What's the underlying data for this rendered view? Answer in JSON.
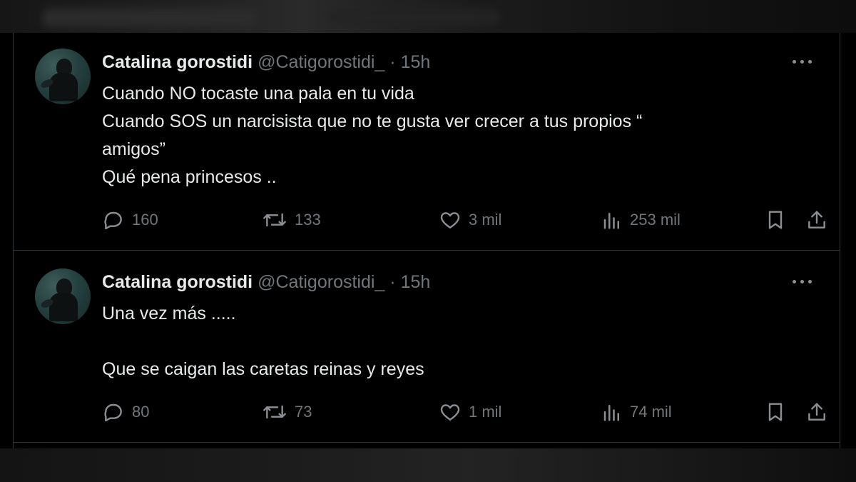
{
  "tweets": [
    {
      "author_name": "Catalina gorostidi",
      "handle": "@Catigorostidi_",
      "separator": "·",
      "time": "15h",
      "lines": [
        "Cuando NO tocaste una pala en tu vida",
        "Cuando SOS un narcisista que no te gusta ver crecer a tus propios “",
        "amigos”",
        "Qué pena princesos .."
      ],
      "replies": "160",
      "retweets": "133",
      "likes": "3 mil",
      "views": "253 mil"
    },
    {
      "author_name": "Catalina gorostidi",
      "handle": "@Catigorostidi_",
      "separator": "·",
      "time": "15h",
      "lines": [
        "Una vez más .....",
        "",
        "Que se caigan las caretas reinas y reyes"
      ],
      "replies": "80",
      "retweets": "73",
      "likes": "1 mil",
      "views": "74 mil"
    }
  ],
  "icons": {
    "reply": "speech-bubble-icon",
    "retweet": "retweet-icon",
    "like": "heart-icon",
    "views": "bar-chart-icon",
    "bookmark": "bookmark-icon",
    "share": "share-icon",
    "more": "more-dots-icon"
  },
  "colors": {
    "background": "#000000",
    "text": "#e7e9ea",
    "secondary": "#71767b",
    "border": "#2f3336"
  }
}
